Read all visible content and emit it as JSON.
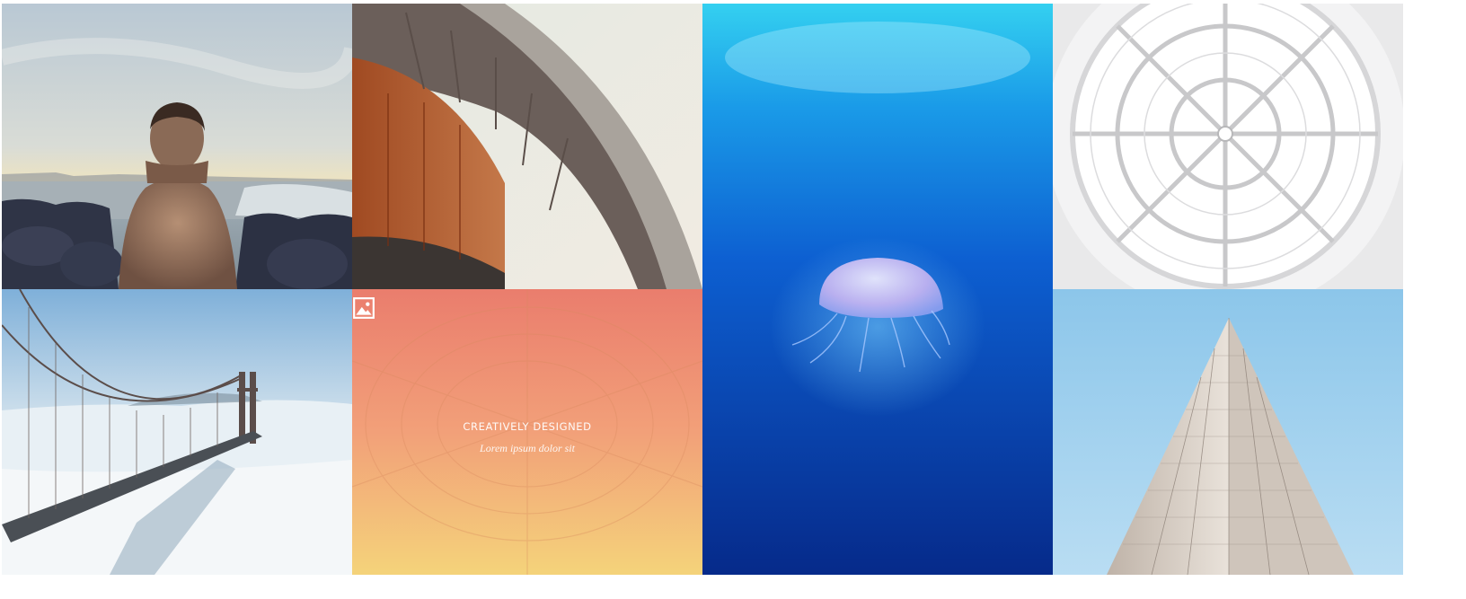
{
  "gallery": {
    "featured_tile": {
      "icon": "image-icon",
      "title": "CREATIVELY DESIGNED",
      "subtitle": "Lorem ipsum dolor sit"
    },
    "tiles": [
      {
        "name": "man-by-sea",
        "alt": "Man standing on rocks by the sea"
      },
      {
        "name": "curved-architecture",
        "alt": "Curved building overhang"
      },
      {
        "name": "jellyfish",
        "alt": "Jellyfish underwater"
      },
      {
        "name": "skylight-dome",
        "alt": "White skylight dome"
      },
      {
        "name": "golden-gate-bridge",
        "alt": "Bridge over fog"
      },
      {
        "name": "featured-gradient",
        "alt": "Gradient overlay tile"
      },
      {
        "name": "skyscraper",
        "alt": "Skyscraper seen from below"
      }
    ]
  }
}
